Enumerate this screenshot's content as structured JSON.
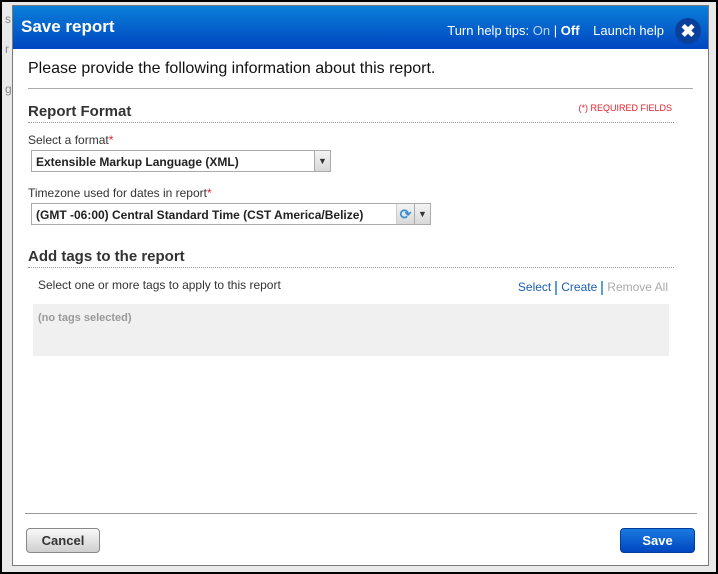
{
  "dialog": {
    "title": "Save report",
    "help_tips_label": "Turn help tips:",
    "help_on": "On",
    "help_sep": "|",
    "help_off": "Off",
    "launch_help": "Launch help",
    "close_glyph": "✖",
    "intro": "Please provide the following information about this report.",
    "required_note": "(*) REQUIRED FIELDS"
  },
  "format_section": {
    "heading": "Report Format",
    "format_label": "Select a format",
    "format_value": "Extensible Markup Language (XML)",
    "timezone_label": "Timezone used for dates in report",
    "timezone_value": "(GMT -06:00) Central Standard Time (CST America/Belize)",
    "required_mark": "*"
  },
  "tags_section": {
    "heading": "Add tags to the report",
    "description": "Select one or more tags to apply to this report",
    "select_link": "Select",
    "create_link": "Create",
    "remove_all_link": "Remove All",
    "empty_text": "(no tags selected)"
  },
  "footer": {
    "cancel_label": "Cancel",
    "save_label": "Save"
  },
  "colors": {
    "header_blue": "#0a5fd0",
    "required_red": "#e0202a",
    "link_blue": "#1b5fae"
  }
}
